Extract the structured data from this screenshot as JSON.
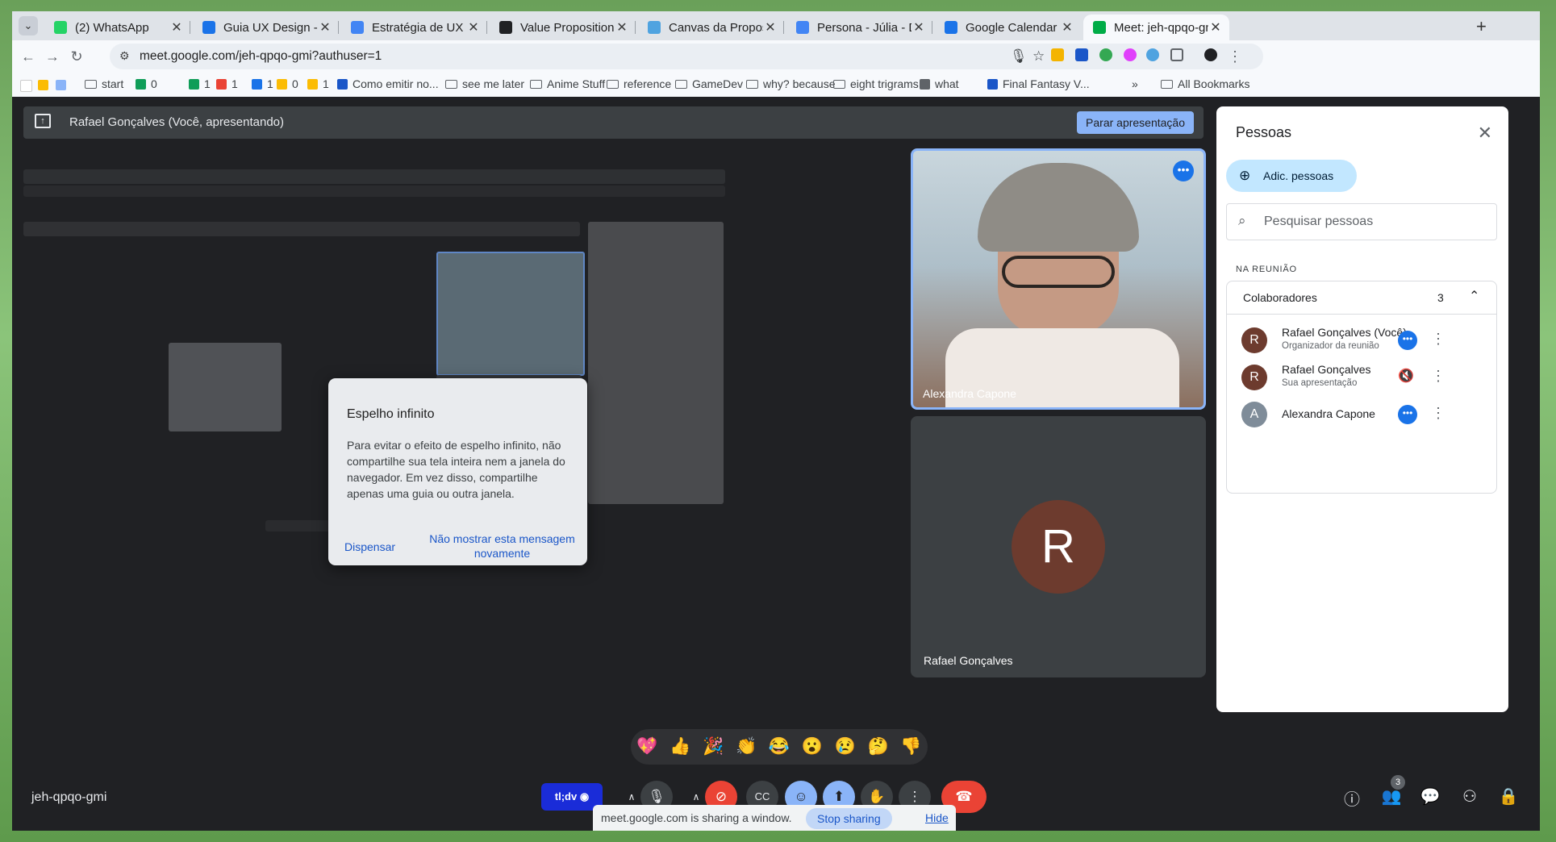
{
  "browser": {
    "tabs": [
      {
        "label": "(2) WhatsApp",
        "color": "#25d366",
        "icon": "whatsapp-icon"
      },
      {
        "label": "Guia UX Design - LABF",
        "color": "#1a73e8",
        "icon": "drive-icon"
      },
      {
        "label": "Estratégia de UX - Lab",
        "color": "#4285f4",
        "icon": "docs-icon"
      },
      {
        "label": "Value Proposition Canv",
        "color": "#202124",
        "icon": "site-icon"
      },
      {
        "label": "Canvas da Proposta de",
        "color": "#4fa3e0",
        "icon": "slides-icon"
      },
      {
        "label": "Persona - Júlia - Docum",
        "color": "#4285f4",
        "icon": "docs-icon"
      },
      {
        "label": "Google Calendar - May",
        "color": "#1a73e8",
        "icon": "calendar-icon"
      },
      {
        "label": "Meet: jeh-qpqo-gmi",
        "color": "#00ac47",
        "icon": "meet-icon"
      }
    ],
    "url": "meet.google.com/jeh-qpqo-gmi?authuser=1",
    "bookmarks": [
      {
        "label": "start",
        "type": "folder"
      },
      {
        "label": "0",
        "type": "icon",
        "color": "#0f9d58"
      },
      {
        "label": "1",
        "type": "icon",
        "color": "#0f9d58"
      },
      {
        "label": "1",
        "type": "icon",
        "color": "#ea4335"
      },
      {
        "label": "1",
        "type": "icon",
        "color": "#1a73e8"
      },
      {
        "label": "0",
        "type": "icon",
        "color": "#fbbc04"
      },
      {
        "label": "1",
        "type": "icon",
        "color": "#fbbc04"
      },
      {
        "label": "Como emitir no...",
        "type": "icon",
        "color": "#1a56c8"
      },
      {
        "label": "see me later",
        "type": "folder"
      },
      {
        "label": "Anime Stuff",
        "type": "folder"
      },
      {
        "label": "reference",
        "type": "folder"
      },
      {
        "label": "GameDev",
        "type": "folder"
      },
      {
        "label": "why? because",
        "type": "folder"
      },
      {
        "label": "eight trigrams",
        "type": "folder"
      },
      {
        "label": "what",
        "type": "icon",
        "color": "#5f6368"
      },
      {
        "label": "Final Fantasy V...",
        "type": "icon",
        "color": "#1a56c8"
      }
    ],
    "all_bookmarks": "All Bookmarks",
    "more_bookmarks": "»"
  },
  "meet": {
    "presenting_text": "Rafael Gonçalves (Você, apresentando)",
    "stop_presenting": "Parar apresentação",
    "dialog": {
      "title": "Espelho infinito",
      "body": "Para evitar o efeito de espelho infinito, não compartilhe sua tela inteira nem a janela do navegador. Em vez disso, compartilhe apenas uma guia ou outra janela.",
      "dismiss": "Dispensar",
      "dont_show": "Não mostrar esta mensagem novamente"
    },
    "tiles": {
      "alexandra": {
        "name": "Alexandra Capone"
      },
      "rafael": {
        "name": "Rafael Gonçalves",
        "initial": "R"
      }
    },
    "reactions": [
      "💖",
      "👍",
      "🎉",
      "👏",
      "😂",
      "😮",
      "😢",
      "🤔",
      "👎"
    ],
    "meeting_code": "jeh-qpqo-gmi",
    "tldv_label": "tl;dv",
    "people_count_badge": "3",
    "share_bar": {
      "text": "meet.google.com is sharing a window.",
      "stop": "Stop sharing",
      "hide": "Hide"
    }
  },
  "people_panel": {
    "title": "Pessoas",
    "add_people": "Adic. pessoas",
    "search_placeholder": "Pesquisar pessoas",
    "section_label": "NA REUNIÃO",
    "group_label": "Colaboradores",
    "group_count": "3",
    "people": [
      {
        "name": "Rafael Gonçalves (Você)",
        "subtitle": "Organizador da reunião",
        "initial": "R",
        "color": "#6d3b2e",
        "status": "speaking"
      },
      {
        "name": "Rafael Gonçalves",
        "subtitle": "Sua apresentação",
        "initial": "R",
        "color": "#6d3b2e",
        "status": "muted"
      },
      {
        "name": "Alexandra Capone",
        "subtitle": "",
        "initial": "A",
        "color": "#7f8c99",
        "status": "speaking"
      }
    ]
  }
}
